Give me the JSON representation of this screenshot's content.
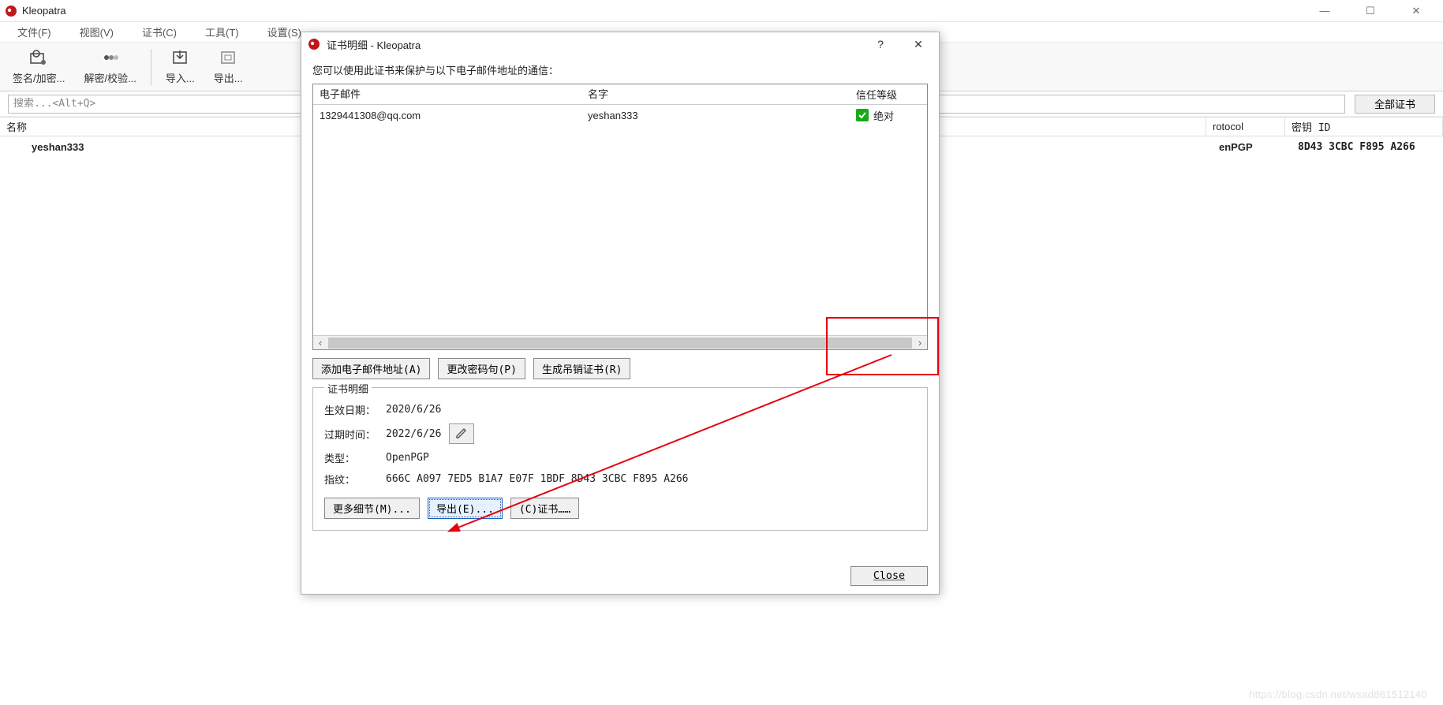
{
  "app": {
    "title": "Kleopatra"
  },
  "menus": {
    "file": "文件(F)",
    "view": "视图(V)",
    "cert": "证书(C)",
    "tools": "工具(T)",
    "settings": "设置(S)"
  },
  "toolbar": {
    "sign": "签名/加密...",
    "decrypt": "解密/校验...",
    "import": "导入...",
    "export": "导出..."
  },
  "filter": {
    "search_placeholder": "搜索...<Alt+Q>",
    "all_certs": "全部证书"
  },
  "list": {
    "headers": {
      "name": "名称",
      "protocol": "rotocol",
      "keyid": "密钥 ID"
    },
    "rows": [
      {
        "name": "yeshan333",
        "protocol": "enPGP",
        "keyid": "8D43 3CBC F895 A266"
      }
    ]
  },
  "dialog": {
    "title": "证书明细 - Kleopatra",
    "desc": "您可以使用此证书来保护与以下电子邮件地址的通信：",
    "columns": {
      "email": "电子邮件",
      "name": "名字",
      "trust": "信任等级"
    },
    "rows": [
      {
        "email": "1329441308@qq.com",
        "name": "yeshan333",
        "trust": "绝对"
      }
    ],
    "actions": {
      "add_email": "添加电子邮件地址(A)",
      "change_pass": "更改密码句(P)",
      "gen_revoke": "生成吊销证书(R)"
    },
    "group_label": "证书明细",
    "detail_labels": {
      "effective": "生效日期：",
      "expiry": "过期时间：",
      "type": "类型：",
      "fingerprint": "指纹："
    },
    "detail_values": {
      "effective": "2020/6/26",
      "expiry": "2022/6/26",
      "type": "OpenPGP",
      "fingerprint": "666C A097 7ED5 B1A7 E07F  1BDF 8D43 3CBC F895 A266"
    },
    "detail_actions": {
      "more": "更多细节(M)...",
      "export": "导出(E)...",
      "cert": "(C)证书……"
    },
    "close": "Close"
  },
  "watermark": "https://blog.csdn.net/wsad861512140"
}
